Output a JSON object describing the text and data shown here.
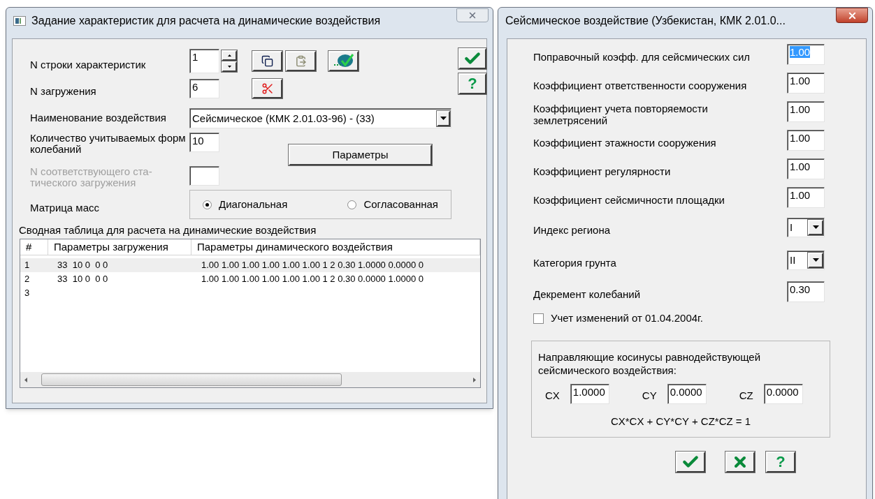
{
  "left_window": {
    "title": "Задание характеристик для расчета на динамические воздействия",
    "row_number": {
      "label": "N строки характеристик",
      "value": "1"
    },
    "load_number": {
      "label": "N загружения",
      "value": "6"
    },
    "action_name": {
      "label": "Наименование воздействия",
      "value": "Сейсмическое (КМК 2.01.03-96) - (33)"
    },
    "modes_count": {
      "label": "Количество учитываемых форм колебаний",
      "value": "10"
    },
    "params_button": "Параметры",
    "static_load": {
      "label": "N соответствующего ста-тического загружения",
      "disabled": true
    },
    "mass_matrix": {
      "label": "Матрица масс",
      "options": [
        {
          "label": "Диагональная",
          "selected": true
        },
        {
          "label": "Согласованная",
          "selected": false
        }
      ]
    },
    "help": "?",
    "table": {
      "caption": "Сводная таблица для расчета на динамические воздействия",
      "columns": [
        "#",
        "Параметры загружения",
        "Параметры динамического воздействия"
      ],
      "rows": [
        {
          "cells": [
            "1",
            "33  10 0  0 0",
            "1.00 1.00 1.00 1.00 1.00 1.00 1 2 0.30 1.0000 0.0000 0"
          ],
          "selected": true
        },
        {
          "cells": [
            "2",
            "33  10 0  0 0",
            "1.00 1.00 1.00 1.00 1.00 1.00 1 2 0.30 0.0000 1.0000 0"
          ],
          "selected": false
        },
        {
          "cells": [
            "3"
          ],
          "selected": false
        }
      ]
    }
  },
  "right_window": {
    "title": "Сейсмическое воздействие (Узбекистан, КМК 2.01.0...",
    "rows": [
      {
        "kind": "input",
        "label": "Поправочный коэфф. для сейсмических сил",
        "value": "1.00",
        "text_selected": true
      },
      {
        "kind": "input",
        "label": "Коэффициент ответственности сооружения",
        "value": "1.00",
        "text_selected": false
      },
      {
        "kind": "input",
        "label": "Коэффициент учета повторяемости землетрясений",
        "value": "1.00",
        "text_selected": false
      },
      {
        "kind": "input",
        "label": "Коэффициент этажности сооружения",
        "value": "1.00",
        "text_selected": false
      },
      {
        "kind": "input",
        "label": "Коэффициент регулярности",
        "value": "1.00",
        "text_selected": false
      },
      {
        "kind": "input",
        "label": "Коэффициент сейсмичности площадки",
        "value": "1.00",
        "text_selected": false
      },
      {
        "kind": "select",
        "label": "Индекс региона",
        "value": "I",
        "text_selected": false
      },
      {
        "kind": "select",
        "label": "Категория грунта",
        "value": "II",
        "text_selected": false
      },
      {
        "kind": "input",
        "label": "Декремент колебаний",
        "value": "0.30",
        "text_selected": false
      }
    ],
    "checkbox": {
      "label": "Учет изменений от 01.04.2004г.",
      "checked": false
    },
    "cosines": {
      "caption": "Направляющие косинусы равнодействующей сейсмического воздействия:",
      "items": [
        {
          "label": "CX",
          "value": "1.0000"
        },
        {
          "label": "CY",
          "value": "0.0000"
        },
        {
          "label": "CZ",
          "value": "0.0000"
        }
      ],
      "formula": "CX*CX + CY*CY + CZ*CZ = 1"
    },
    "help": "?"
  }
}
